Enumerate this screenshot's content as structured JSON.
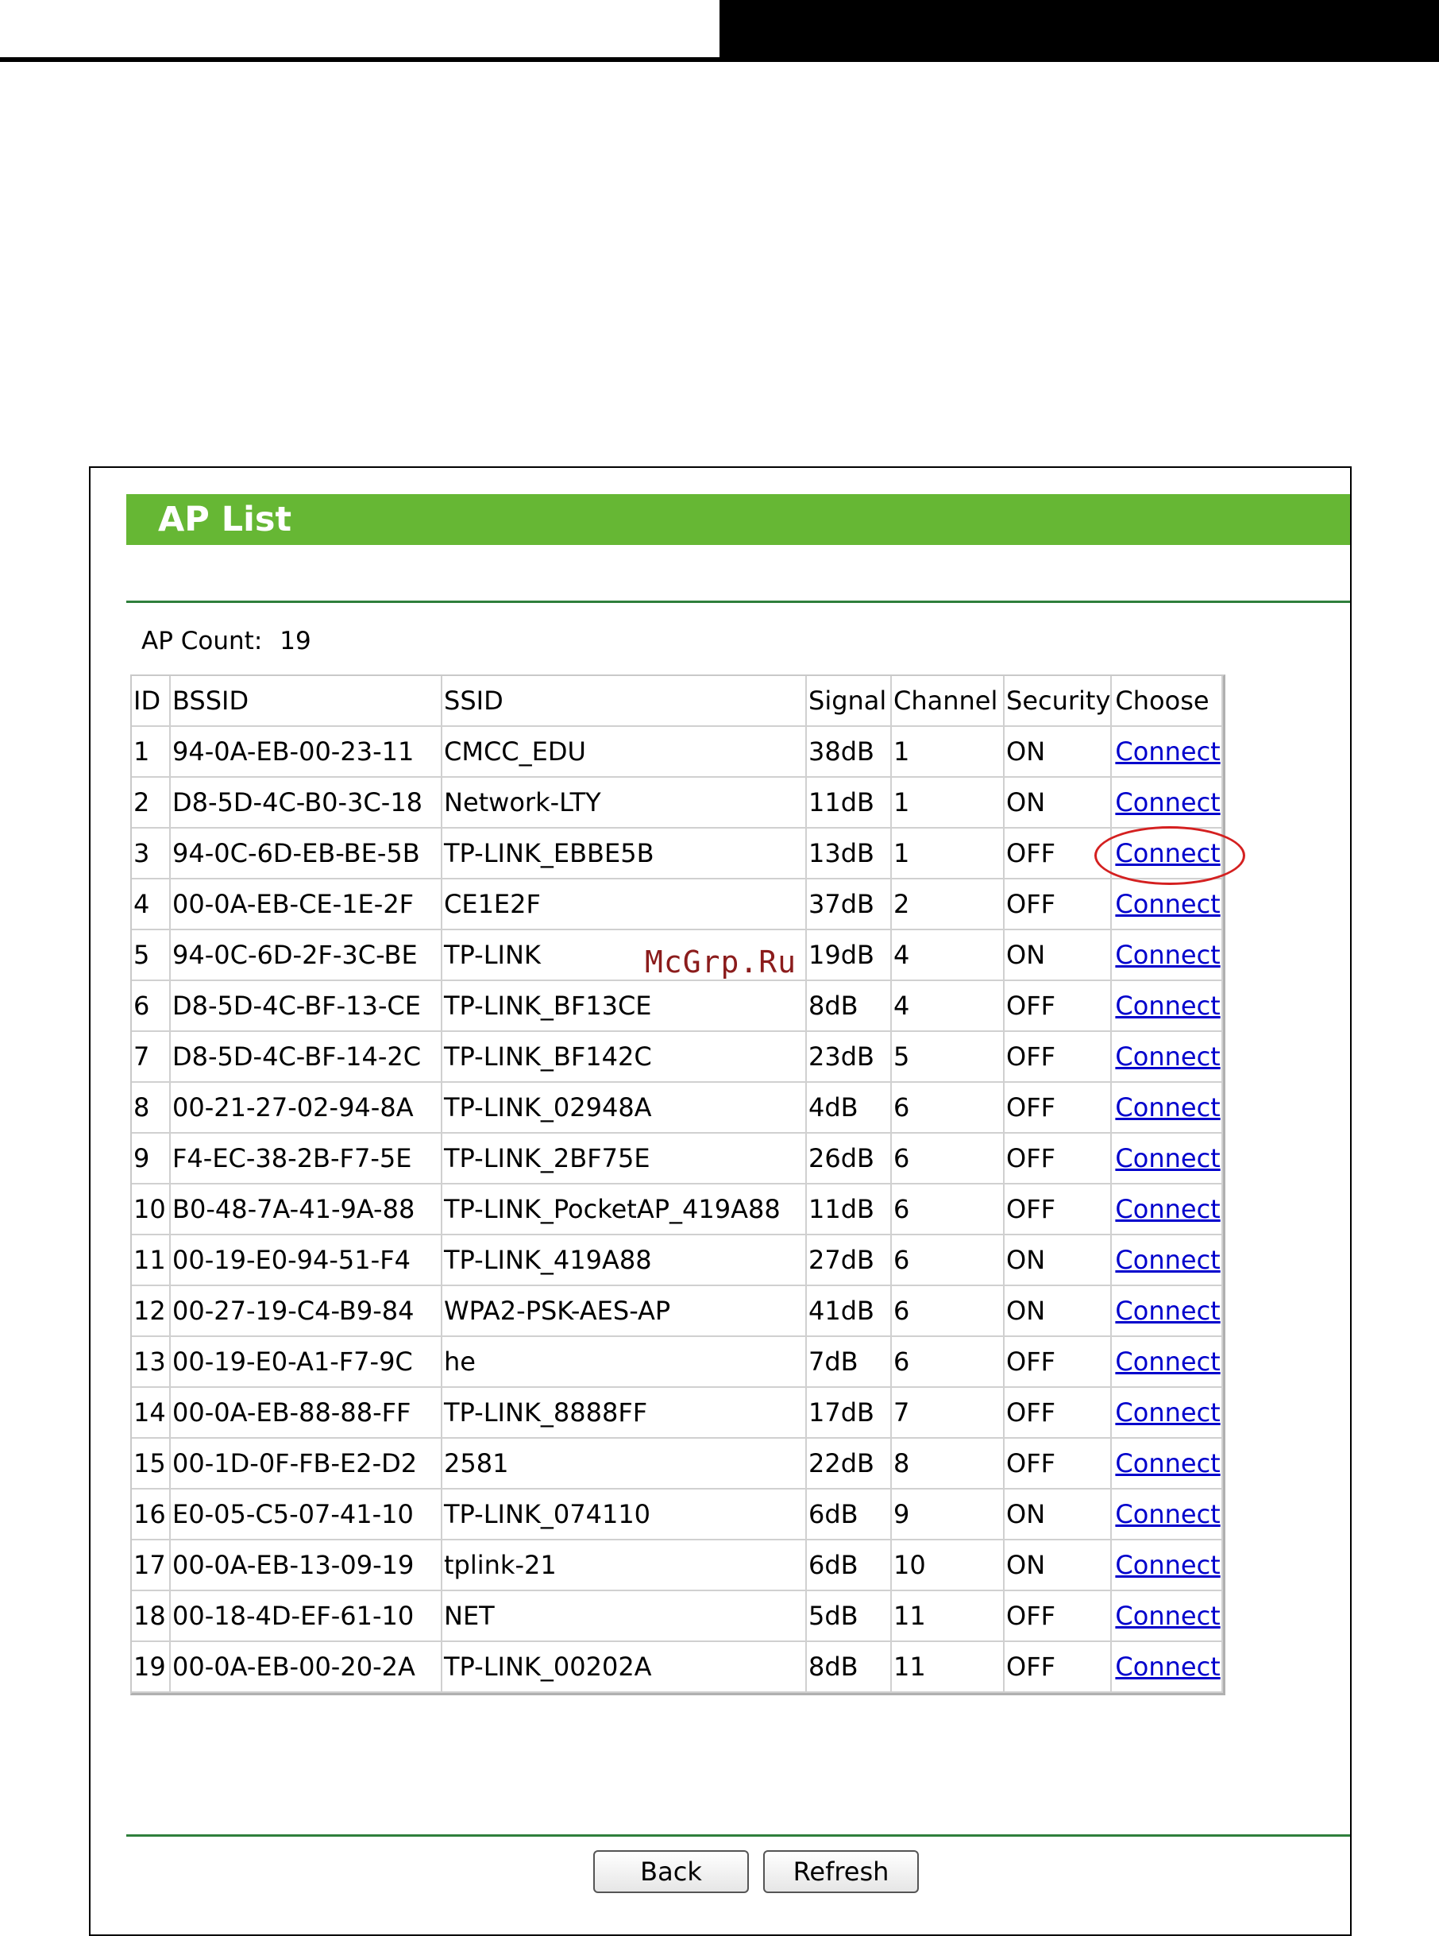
{
  "page": {
    "title": "AP List"
  },
  "ap_count": {
    "label": "AP Count:",
    "value": "19"
  },
  "table": {
    "headers": [
      "ID",
      "BSSID",
      "SSID",
      "Signal",
      "Channel",
      "Security",
      "Choose"
    ],
    "rows": [
      [
        "1",
        "94-0A-EB-00-23-11",
        "CMCC_EDU",
        "38dB",
        "1",
        "ON",
        "Connect"
      ],
      [
        "2",
        "D8-5D-4C-B0-3C-18",
        "Network-LTY",
        "11dB",
        "1",
        "ON",
        "Connect"
      ],
      [
        "3",
        "94-0C-6D-EB-BE-5B",
        "TP-LINK_EBBE5B",
        "13dB",
        "1",
        "OFF",
        "Connect"
      ],
      [
        "4",
        "00-0A-EB-CE-1E-2F",
        "CE1E2F",
        "37dB",
        "2",
        "OFF",
        "Connect"
      ],
      [
        "5",
        "94-0C-6D-2F-3C-BE",
        "TP-LINK",
        "19dB",
        "4",
        "ON",
        "Connect"
      ],
      [
        "6",
        "D8-5D-4C-BF-13-CE",
        "TP-LINK_BF13CE",
        "8dB",
        "4",
        "OFF",
        "Connect"
      ],
      [
        "7",
        "D8-5D-4C-BF-14-2C",
        "TP-LINK_BF142C",
        "23dB",
        "5",
        "OFF",
        "Connect"
      ],
      [
        "8",
        "00-21-27-02-94-8A",
        "TP-LINK_02948A",
        "4dB",
        "6",
        "OFF",
        "Connect"
      ],
      [
        "9",
        "F4-EC-38-2B-F7-5E",
        "TP-LINK_2BF75E",
        "26dB",
        "6",
        "OFF",
        "Connect"
      ],
      [
        "10",
        "B0-48-7A-41-9A-88",
        "TP-LINK_PocketAP_419A88",
        "11dB",
        "6",
        "OFF",
        "Connect"
      ],
      [
        "11",
        "00-19-E0-94-51-F4",
        "TP-LINK_419A88",
        "27dB",
        "6",
        "ON",
        "Connect"
      ],
      [
        "12",
        "00-27-19-C4-B9-84",
        "WPA2-PSK-AES-AP",
        "41dB",
        "6",
        "ON",
        "Connect"
      ],
      [
        "13",
        "00-19-E0-A1-F7-9C",
        "he",
        "7dB",
        "6",
        "OFF",
        "Connect"
      ],
      [
        "14",
        "00-0A-EB-88-88-FF",
        "TP-LINK_8888FF",
        "17dB",
        "7",
        "OFF",
        "Connect"
      ],
      [
        "15",
        "00-1D-0F-FB-E2-D2",
        "2581",
        "22dB",
        "8",
        "OFF",
        "Connect"
      ],
      [
        "16",
        "E0-05-C5-07-41-10",
        "TP-LINK_074110",
        "6dB",
        "9",
        "ON",
        "Connect"
      ],
      [
        "17",
        "00-0A-EB-13-09-19",
        "tplink-21",
        "6dB",
        "10",
        "ON",
        "Connect"
      ],
      [
        "18",
        "00-18-4D-EF-61-10",
        "NET",
        "5dB",
        "11",
        "OFF",
        "Connect"
      ],
      [
        "19",
        "00-0A-EB-00-20-2A",
        "TP-LINK_00202A",
        "8dB",
        "11",
        "OFF",
        "Connect"
      ]
    ]
  },
  "watermark": "McGrp.Ru",
  "buttons": {
    "back": "Back",
    "refresh": "Refresh"
  },
  "colors": {
    "header_green": "#66b734",
    "divider_green": "#2f7f3c",
    "link_blue": "#0000cc",
    "highlight_red": "#d42020"
  }
}
